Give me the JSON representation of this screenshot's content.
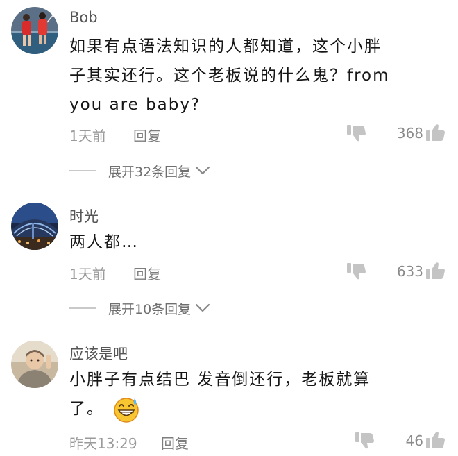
{
  "comments": [
    {
      "username": "Bob",
      "lines": [
        "如果有点语法知识的人都知道，这个小胖",
        "子其实还行。这个老板说的什么鬼？from",
        "you are baby?"
      ],
      "time": "1天前",
      "reply_label": "回复",
      "like_count": "368",
      "expand_label": "展开32条回复"
    },
    {
      "username": "时光",
      "lines": [
        "两人都…"
      ],
      "time": "1天前",
      "reply_label": "回复",
      "like_count": "633",
      "expand_label": "展开10条回复"
    },
    {
      "username": "应该是吧",
      "lines": [
        "小胖子有点结巴 发音倒还行，老板就算",
        "了。"
      ],
      "time": "昨天13:29",
      "reply_label": "回复",
      "like_count": "46"
    }
  ],
  "icons": {
    "like": "thumbs-up-icon",
    "dislike": "thumbs-down-icon",
    "expand": "chevron-down-icon",
    "emoji": "grinning-sweat-emoji"
  },
  "colors": {
    "text": "#161616",
    "meta": "#9a9a9a",
    "icon": "#c4c4c4"
  }
}
